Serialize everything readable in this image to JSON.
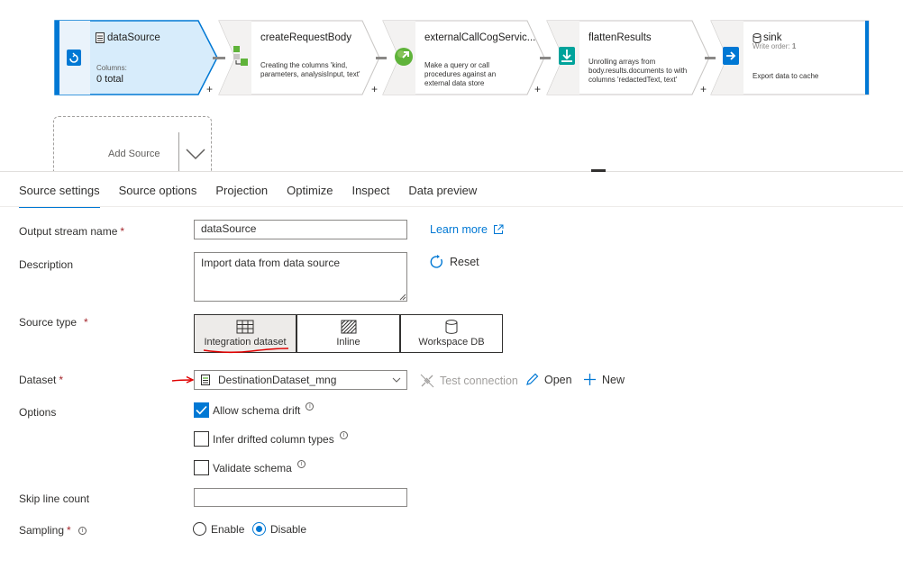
{
  "pipeline": {
    "source_node": {
      "title": "dataSource",
      "columns_label": "Columns:",
      "columns_value": "0 total"
    },
    "nodes": [
      {
        "title": "createRequestBody",
        "desc": "Creating the columns 'kind, parameters, analysisInput, text'"
      },
      {
        "title": "externalCallCogServic...",
        "desc": "Make a query or call procedures against an external data store"
      },
      {
        "title": "flattenResults",
        "desc": "Unrolling arrays from body.results.documents to with columns 'redactedText, text'"
      }
    ],
    "sink_node": {
      "title": "sink",
      "write_order_label": "Write order:",
      "write_order_value": "1",
      "desc": "Export data to cache"
    },
    "plus": "+",
    "add_source_label": "Add Source"
  },
  "tabs": [
    {
      "label": "Source settings",
      "active": true
    },
    {
      "label": "Source options"
    },
    {
      "label": "Projection"
    },
    {
      "label": "Optimize"
    },
    {
      "label": "Inspect"
    },
    {
      "label": "Data preview"
    }
  ],
  "form": {
    "required_mark": "*",
    "output_stream": {
      "label": "Output stream name",
      "value": "dataSource"
    },
    "learn_more": "Learn more",
    "description": {
      "label": "Description",
      "value": "Import data from data source"
    },
    "reset": "Reset",
    "source_type": {
      "label": "Source type",
      "options": [
        "Integration dataset",
        "Inline",
        "Workspace DB"
      ],
      "selected": "Integration dataset"
    },
    "dataset": {
      "label": "Dataset",
      "value": "DestinationDataset_mng",
      "test_connection": "Test connection",
      "open": "Open",
      "new": "New"
    },
    "options": {
      "label": "Options",
      "allow_schema_drift": "Allow schema drift",
      "allow_schema_drift_checked": true,
      "infer_drifted": "Infer drifted column types",
      "validate_schema": "Validate schema"
    },
    "skip_line_count": {
      "label": "Skip line count",
      "value": ""
    },
    "sampling": {
      "label": "Sampling",
      "enable": "Enable",
      "disable": "Disable",
      "selected": "Disable"
    }
  },
  "colors": {
    "accent": "#0078d4",
    "annotation_red": "#e00000",
    "selected_node_fill": "#d7ecfb"
  }
}
